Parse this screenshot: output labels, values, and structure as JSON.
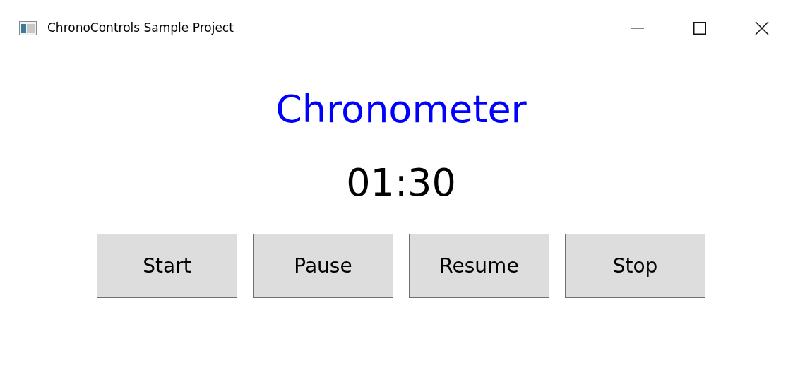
{
  "window": {
    "title": "ChronoControls Sample Project"
  },
  "heading": "Chronometer",
  "time": "01:30",
  "buttons": [
    "Start",
    "Pause",
    "Resume",
    "Stop"
  ]
}
